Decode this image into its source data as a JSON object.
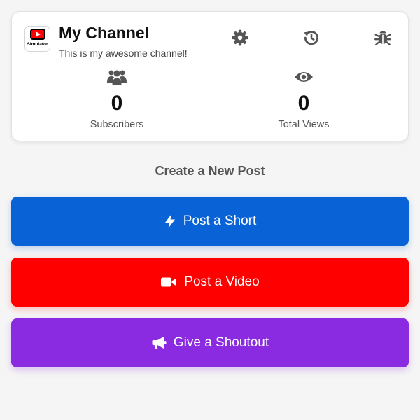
{
  "channel": {
    "logo_text": "Simulator",
    "logo_icon": "youtube-play-icon",
    "name": "My Channel",
    "description": "This is my awesome channel!"
  },
  "header_icons": [
    {
      "name": "settings",
      "icon": "gear-icon"
    },
    {
      "name": "history",
      "icon": "history-icon"
    },
    {
      "name": "debug",
      "icon": "bug-icon"
    }
  ],
  "stats": {
    "subscribers": {
      "value": "0",
      "label": "Subscribers",
      "icon": "users-icon"
    },
    "views": {
      "value": "0",
      "label": "Total Views",
      "icon": "eye-icon"
    }
  },
  "create": {
    "title": "Create a New Post",
    "buttons": {
      "short": {
        "label": "Post a Short",
        "icon": "bolt-icon",
        "color": "#0a63d6"
      },
      "video": {
        "label": "Post a Video",
        "icon": "video-camera-icon",
        "color": "#ff0000"
      },
      "shoutout": {
        "label": "Give a Shoutout",
        "icon": "megaphone-icon",
        "color": "#8a2be2"
      }
    }
  },
  "colors": {
    "icon_gray": "#555555",
    "background": "#f5f5f5"
  }
}
